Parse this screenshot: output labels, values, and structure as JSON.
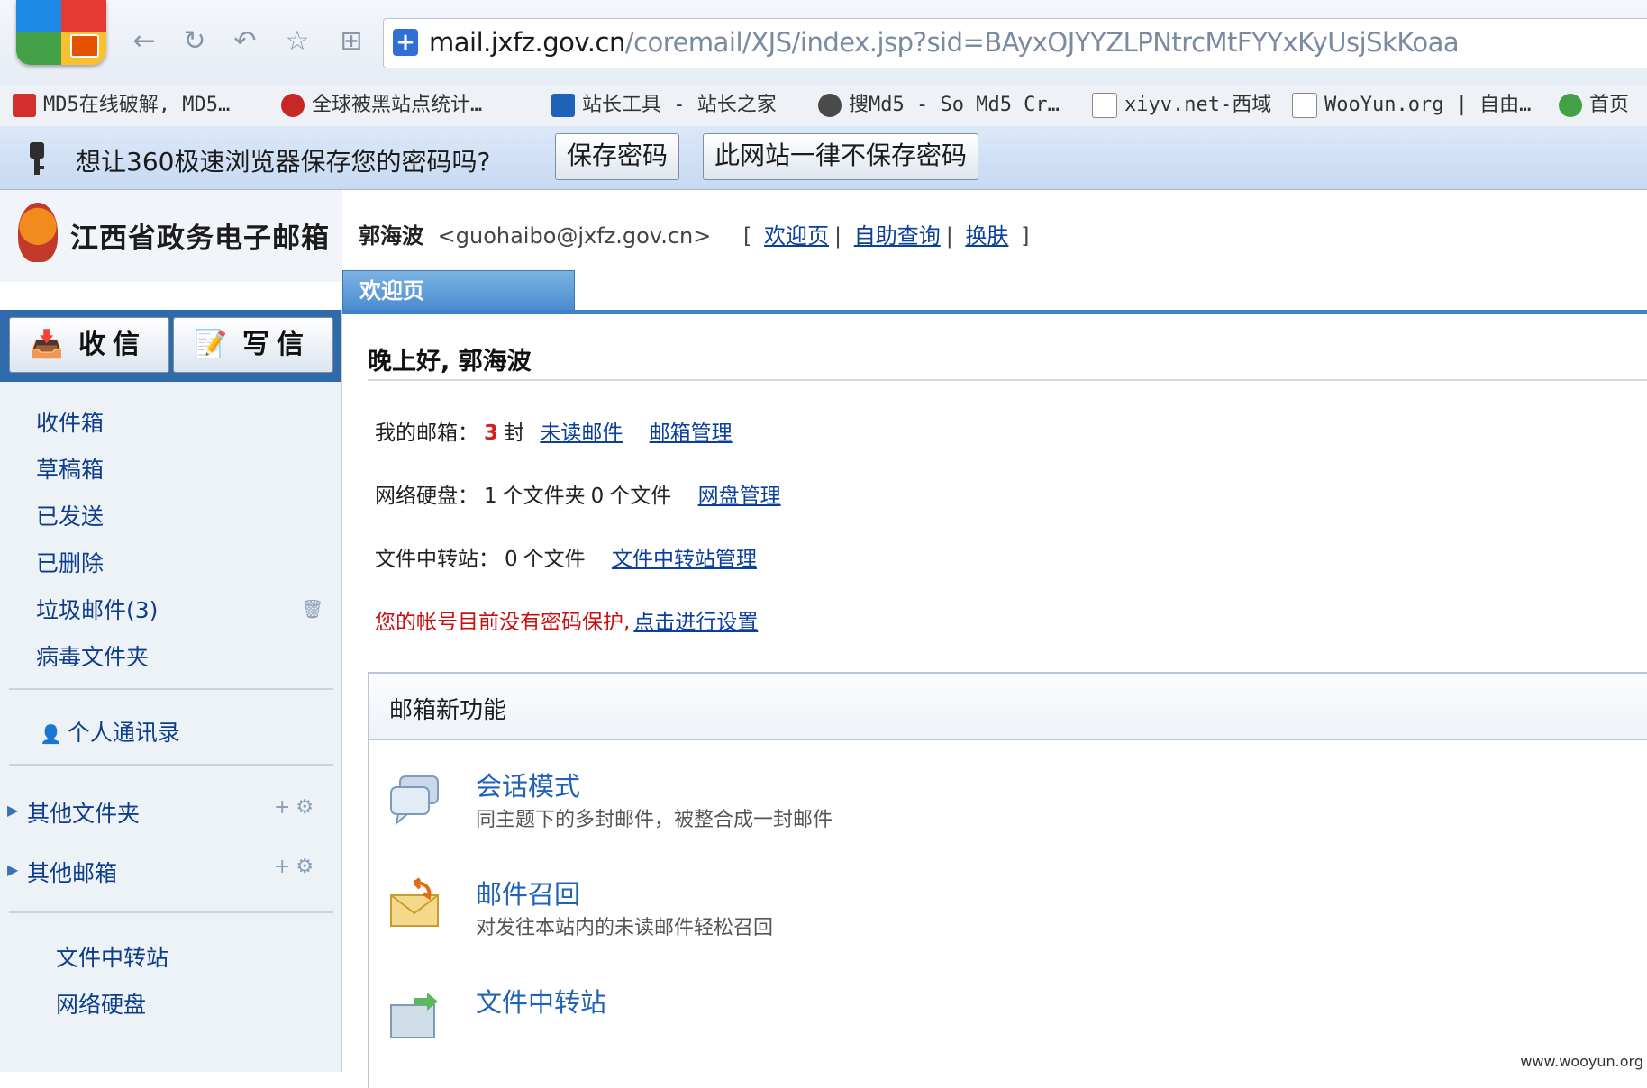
{
  "browser": {
    "url_host": "mail.jxfz.gov.cn",
    "url_path": "/coremail/XJS/index.jsp?sid=BAyxOJYYZLPNtrcMtFYYxKyUsjSkKoaa",
    "bookmarks": [
      "MD5在线破解, MD5…",
      "全球被黑站点统计…",
      "站长工具 - 站长之家",
      "搜Md5 - So Md5 Cr…",
      "xiyv.net-西域",
      "WooYun.org | 自由…",
      "首页"
    ],
    "password_prompt": "想让360极速浏览器保存您的密码吗?",
    "save_password": "保存密码",
    "never_save": "此网站一律不保存密码"
  },
  "brand": {
    "name": "江西省政务电子邮箱"
  },
  "user": {
    "name": "郭海波",
    "email": "<guohaibo@jxfz.gov.cn>",
    "link_open": "[",
    "link_close": "]",
    "links": [
      "欢迎页",
      "自助查询",
      "换肤"
    ]
  },
  "tabs": [
    "欢迎页"
  ],
  "actions": {
    "receive": "收信",
    "compose": "写信"
  },
  "folders": [
    "收件箱",
    "草稿箱",
    "已发送",
    "已删除",
    "垃圾邮件(3)",
    "病毒文件夹"
  ],
  "contacts": "个人通讯录",
  "tree": [
    "其他文件夹",
    "其他邮箱"
  ],
  "tools": [
    "文件中转站",
    "网络硬盘"
  ],
  "main": {
    "greeting": "晚上好, 郭海波",
    "mailbox_label": "我的邮箱：",
    "unread_count": "3",
    "unread_unit": "封",
    "unread_link": "未读邮件",
    "mailbox_manage": "邮箱管理",
    "disk_label": "网络硬盘：",
    "disk_folders": "1",
    "disk_folder_unit": "个文件夹",
    "disk_files": "0",
    "disk_file_unit": "个文件",
    "disk_manage": "网盘管理",
    "transfer_label": "文件中转站：",
    "transfer_files": "0",
    "transfer_unit": "个文件",
    "transfer_manage": "文件中转站管理",
    "warning": "您的帐号目前没有密码保护,",
    "warning_link": "点击进行设置"
  },
  "new_features": {
    "title": "邮箱新功能",
    "items": [
      {
        "title": "会话模式",
        "desc": "同主题下的多封邮件，被整合成一封邮件"
      },
      {
        "title": "邮件召回",
        "desc": "对发往本站内的未读邮件轻松召回"
      },
      {
        "title": "文件中转站",
        "desc": ""
      }
    ]
  },
  "watermark": "www.wooyun.org"
}
